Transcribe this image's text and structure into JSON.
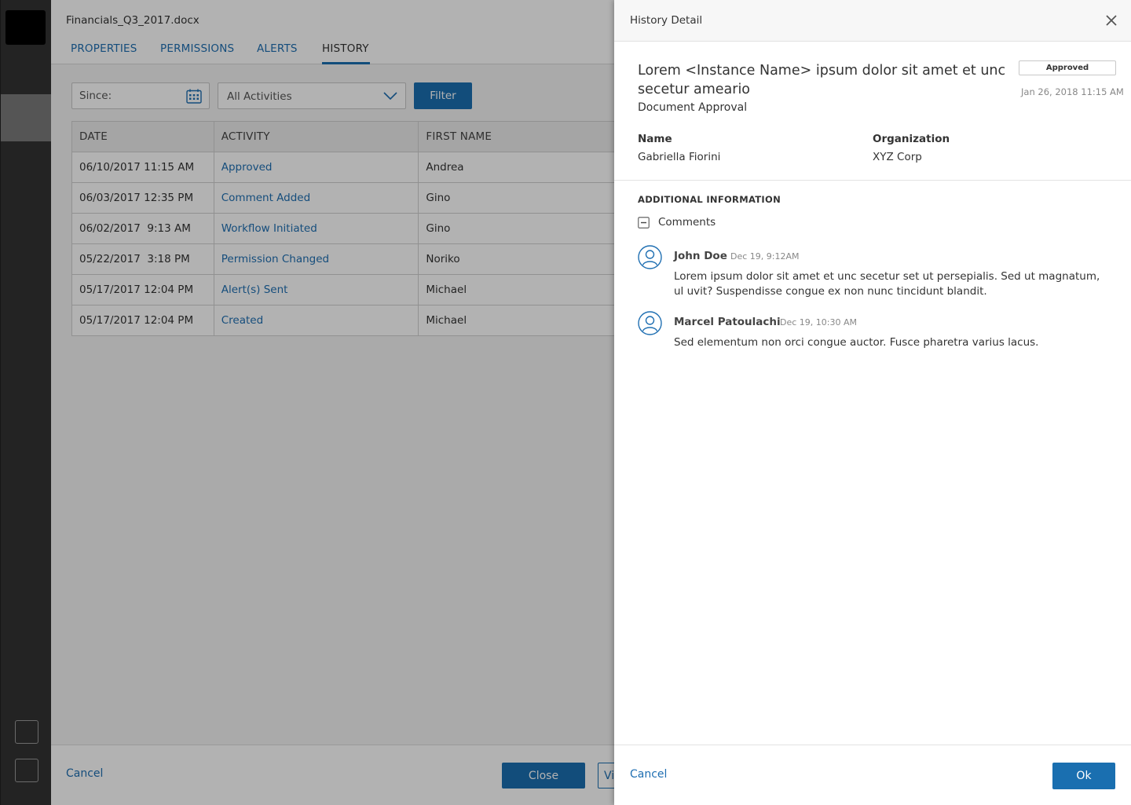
{
  "document": {
    "title": "Financials_Q3_2017.docx",
    "tabs": [
      {
        "label": "PROPERTIES"
      },
      {
        "label": "PERMISSIONS"
      },
      {
        "label": "ALERTS"
      },
      {
        "label": "HISTORY",
        "active": true
      }
    ],
    "filters": {
      "since_placeholder": "Since:",
      "activity_selected": "All Activities",
      "filter_label": "Filter"
    },
    "table": {
      "columns": [
        "DATE",
        "ACTIVITY",
        "FIRST NAME"
      ],
      "rows": [
        {
          "date": "06/10/2017 11:15 AM",
          "activity": "Approved",
          "first_name": "Andrea"
        },
        {
          "date": "06/03/2017 12:35 PM",
          "activity": "Comment Added",
          "first_name": "Gino"
        },
        {
          "date": "06/02/2017  9:13 AM",
          "activity": "Workflow Initiated",
          "first_name": "Gino"
        },
        {
          "date": "05/22/2017  3:18 PM",
          "activity": "Permission Changed",
          "first_name": "Noriko"
        },
        {
          "date": "05/17/2017 12:04 PM",
          "activity": "Alert(s) Sent",
          "first_name": "Michael"
        },
        {
          "date": "05/17/2017 12:04 PM",
          "activity": "Created",
          "first_name": "Michael"
        }
      ]
    },
    "footer": {
      "cancel_label": "Cancel",
      "close_label": "Close",
      "view_label": "Vi"
    }
  },
  "drawer": {
    "header_title": "History Detail",
    "instance_title": "Lorem <Instance Name> ipsum dolor sit amet et unc secetur ameario",
    "instance_subtitle": "Document Approval",
    "status": "Approved",
    "status_date": "Jan 26, 2018 11:15 AM",
    "fields": [
      {
        "label": "Name",
        "value": "Gabriella Fiorini"
      },
      {
        "label": "Organization",
        "value": "XYZ Corp"
      }
    ],
    "additional_info_title": "ADDITIONAL INFORMATION",
    "comments_label": "Comments",
    "comments": [
      {
        "author": "John Doe",
        "time": "Dec 19, 9:12AM",
        "text": "Lorem ipsum dolor sit amet et unc secetur set ut persepialis. Sed ut magnatum, ul uvit? Suspendisse congue ex non nunc tincidunt blandit."
      },
      {
        "author": "Marcel Patoulachi",
        "time": "Dec 19, 10:30 AM",
        "text": "Sed elementum non orci congue auctor. Fusce pharetra varius lacus."
      }
    ],
    "footer": {
      "cancel_label": "Cancel",
      "ok_label": "Ok"
    }
  },
  "colors": {
    "accent": "#1a6fb0",
    "link": "#1f6fb2",
    "rail": "#333333"
  }
}
